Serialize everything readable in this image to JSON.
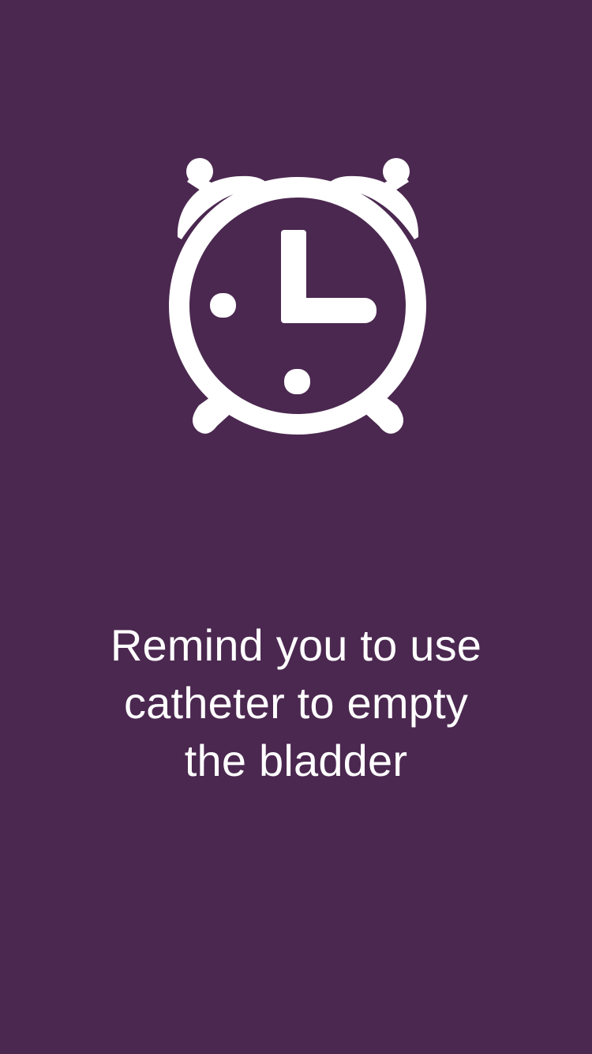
{
  "screen": {
    "background_color": "#4b2850",
    "foreground_color": "#ffffff"
  },
  "illustration": {
    "icon": "alarm-clock-icon"
  },
  "message": {
    "lines": [
      "Remind you to use",
      "catheter to empty",
      "the bladder"
    ]
  }
}
